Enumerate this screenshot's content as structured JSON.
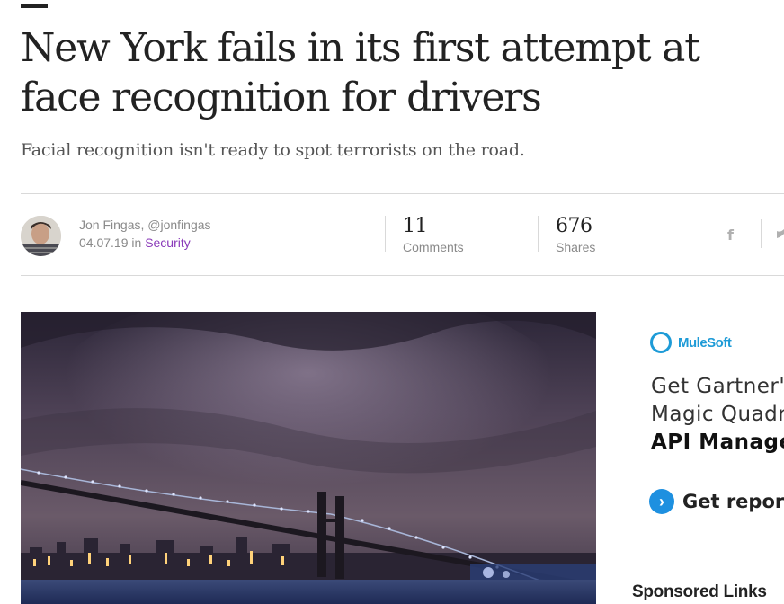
{
  "article": {
    "headline": "New York fails in its first attempt at face recognition for drivers",
    "subheadline": "Facial recognition isn't ready to spot terrorists on the road.",
    "author": "Jon Fingas, @jonfingas",
    "date": "04.07.19",
    "in_word": "in",
    "category": "Security",
    "comments_count": "11",
    "comments_label": "Comments",
    "shares_count": "676",
    "shares_label": "Shares",
    "social": {
      "facebook_icon": "facebook-icon",
      "twitter_icon": "twitter-icon"
    }
  },
  "ad": {
    "brand": "MuleSoft",
    "line1": "Get Gartner's",
    "line2": "Magic Quadra",
    "line3": "API Managen",
    "cta": "Get report",
    "accent_color": "#1e9bd7"
  },
  "sidebar": {
    "sponsored_heading": "Sponsored Links"
  },
  "hero_image": {
    "subject": "night-bridge-photo"
  }
}
